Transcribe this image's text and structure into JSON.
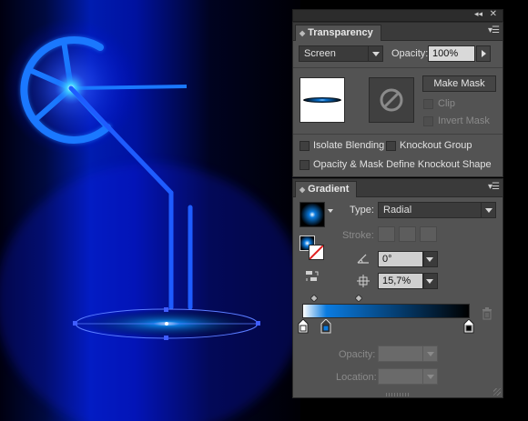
{
  "window": {
    "collapse_glyph": "◂◂",
    "close_glyph": "✕"
  },
  "transparency": {
    "tab_label": "Transparency",
    "blend_mode": "Screen",
    "opacity_label": "Opacity:",
    "opacity_value": "100%",
    "make_mask_label": "Make Mask",
    "clip_label": "Clip",
    "invert_mask_label": "Invert Mask",
    "isolate_blending_label": "Isolate Blending",
    "knockout_group_label": "Knockout Group",
    "opacity_mask_define_label": "Opacity & Mask Define Knockout Shape"
  },
  "gradient": {
    "tab_label": "Gradient",
    "type_label": "Type:",
    "type_value": "Radial",
    "stroke_label": "Stroke:",
    "angle_value": "0°",
    "aspect_value": "15,7%",
    "opacity_label": "Opacity:",
    "location_label": "Location:",
    "stops": [
      {
        "location": 0,
        "color": "#ffffff"
      },
      {
        "location": 14,
        "color": "#0a7be0"
      },
      {
        "location": 100,
        "color": "#000000"
      }
    ]
  },
  "colors": {
    "accent_blue": "#0a7be0",
    "glow_blue": "#1e5cff",
    "panel_bg": "#535353"
  },
  "icons": [
    "double-arrow-icon",
    "close-icon",
    "panel-menu-icon",
    "no-mask-icon",
    "reverse-gradient-icon",
    "angle-icon",
    "aspect-ratio-icon",
    "trash-icon"
  ]
}
